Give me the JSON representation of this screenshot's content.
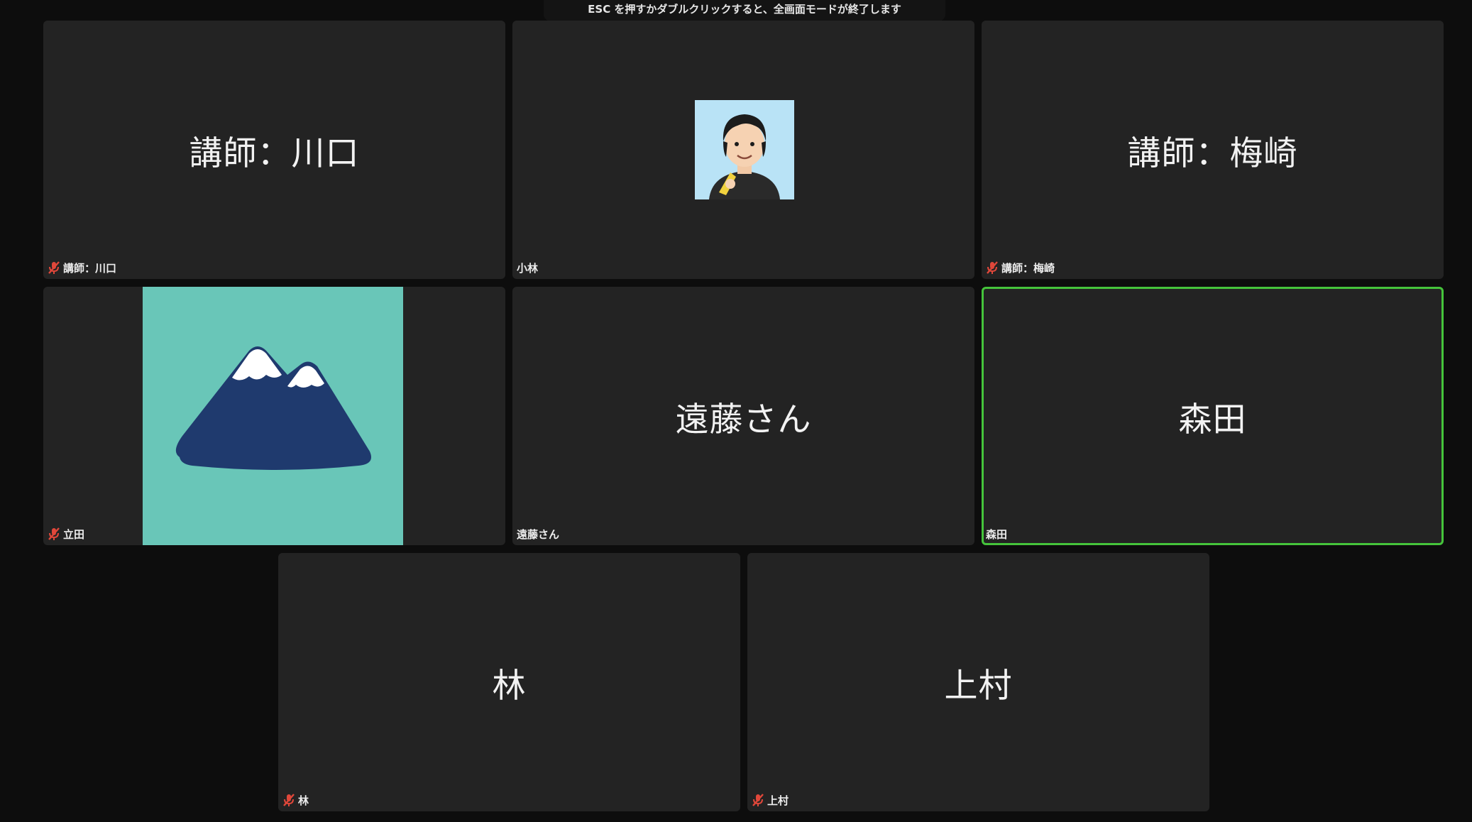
{
  "banner": {
    "text": "ESC を押すかダブルクリックすると、全画面モードが終了します"
  },
  "participants": [
    {
      "display": "講師：川口",
      "label": "講師：川口",
      "muted": true
    },
    {
      "display": "",
      "label": "小林",
      "muted": false,
      "avatar": "illustrated-person-avatar"
    },
    {
      "display": "講師：梅崎",
      "label": "講師：梅崎",
      "muted": true
    },
    {
      "display": "",
      "label": "立田",
      "muted": true,
      "avatar": "mountain-avatar"
    },
    {
      "display": "遠藤さん",
      "label": "遠藤さん",
      "muted": false
    },
    {
      "display": "森田",
      "label": "森田",
      "muted": false,
      "active_speaker": true
    },
    {
      "display": "林",
      "label": "林",
      "muted": true
    },
    {
      "display": "上村",
      "label": "上村",
      "muted": true
    }
  ],
  "colors": {
    "background": "#0d0d0d",
    "tile": "#232323",
    "active_border": "#45c43b",
    "muted_icon": "#e0473a",
    "mountain_bg": "#69c6b8",
    "mountain": "#1f3a6e"
  }
}
